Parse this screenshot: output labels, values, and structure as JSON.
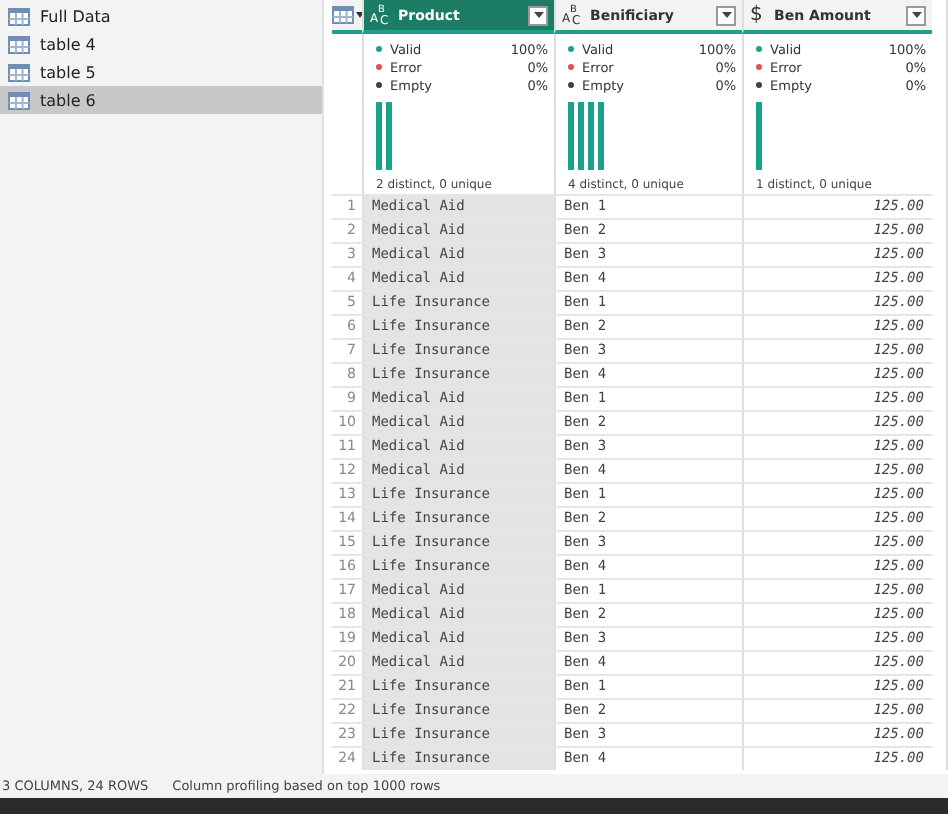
{
  "sidebar": {
    "items": [
      {
        "label": "Full Data",
        "selected": false
      },
      {
        "label": "table 4",
        "selected": false
      },
      {
        "label": "table 5",
        "selected": false
      },
      {
        "label": "table 6",
        "selected": true
      }
    ]
  },
  "table": {
    "columns": [
      {
        "name": "Product",
        "kind": "text",
        "type_glyph": "ABC",
        "selected": true,
        "stats": [
          {
            "label": "Valid",
            "value": "100%",
            "color": "#1aa38a"
          },
          {
            "label": "Error",
            "value": "0%",
            "color": "#e0505a"
          },
          {
            "label": "Empty",
            "value": "0%",
            "color": "#404040"
          }
        ],
        "distinct": "2 distinct, 0 unique"
      },
      {
        "name": "Benificiary",
        "kind": "text",
        "type_glyph": "ABC",
        "selected": false,
        "stats": [
          {
            "label": "Valid",
            "value": "100%",
            "color": "#1aa38a"
          },
          {
            "label": "Error",
            "value": "0%",
            "color": "#e0505a"
          },
          {
            "label": "Empty",
            "value": "0%",
            "color": "#404040"
          }
        ],
        "distinct": "4 distinct, 0 unique"
      },
      {
        "name": "Ben Amount",
        "kind": "currency",
        "type_glyph": "$",
        "selected": false,
        "stats": [
          {
            "label": "Valid",
            "value": "100%",
            "color": "#1aa38a"
          },
          {
            "label": "Error",
            "value": "0%",
            "color": "#e0505a"
          },
          {
            "label": "Empty",
            "value": "0%",
            "color": "#404040"
          }
        ],
        "distinct": "1 distinct, 0 unique"
      }
    ],
    "rows": [
      {
        "number": "1",
        "cells": [
          "Medical Aid",
          "Ben 1",
          "125.00"
        ]
      },
      {
        "number": "2",
        "cells": [
          "Medical Aid",
          "Ben 2",
          "125.00"
        ]
      },
      {
        "number": "3",
        "cells": [
          "Medical Aid",
          "Ben 3",
          "125.00"
        ]
      },
      {
        "number": "4",
        "cells": [
          "Medical Aid",
          "Ben 4",
          "125.00"
        ]
      },
      {
        "number": "5",
        "cells": [
          "Life Insurance",
          "Ben 1",
          "125.00"
        ]
      },
      {
        "number": "6",
        "cells": [
          "Life Insurance",
          "Ben 2",
          "125.00"
        ]
      },
      {
        "number": "7",
        "cells": [
          "Life Insurance",
          "Ben 3",
          "125.00"
        ]
      },
      {
        "number": "8",
        "cells": [
          "Life Insurance",
          "Ben 4",
          "125.00"
        ]
      },
      {
        "number": "9",
        "cells": [
          "Medical Aid",
          "Ben 1",
          "125.00"
        ]
      },
      {
        "number": "10",
        "cells": [
          "Medical Aid",
          "Ben 2",
          "125.00"
        ]
      },
      {
        "number": "11",
        "cells": [
          "Medical Aid",
          "Ben 3",
          "125.00"
        ]
      },
      {
        "number": "12",
        "cells": [
          "Medical Aid",
          "Ben 4",
          "125.00"
        ]
      },
      {
        "number": "13",
        "cells": [
          "Life Insurance",
          "Ben 1",
          "125.00"
        ]
      },
      {
        "number": "14",
        "cells": [
          "Life Insurance",
          "Ben 2",
          "125.00"
        ]
      },
      {
        "number": "15",
        "cells": [
          "Life Insurance",
          "Ben 3",
          "125.00"
        ]
      },
      {
        "number": "16",
        "cells": [
          "Life Insurance",
          "Ben 4",
          "125.00"
        ]
      },
      {
        "number": "17",
        "cells": [
          "Medical Aid",
          "Ben 1",
          "125.00"
        ]
      },
      {
        "number": "18",
        "cells": [
          "Medical Aid",
          "Ben 2",
          "125.00"
        ]
      },
      {
        "number": "19",
        "cells": [
          "Medical Aid",
          "Ben 3",
          "125.00"
        ]
      },
      {
        "number": "20",
        "cells": [
          "Medical Aid",
          "Ben 4",
          "125.00"
        ]
      },
      {
        "number": "21",
        "cells": [
          "Life Insurance",
          "Ben 1",
          "125.00"
        ]
      },
      {
        "number": "22",
        "cells": [
          "Life Insurance",
          "Ben 2",
          "125.00"
        ]
      },
      {
        "number": "23",
        "cells": [
          "Life Insurance",
          "Ben 3",
          "125.00"
        ]
      },
      {
        "number": "24",
        "cells": [
          "Life Insurance",
          "Ben 4",
          "125.00"
        ]
      }
    ]
  },
  "status_bar": {
    "counts": "3 COLUMNS, 24 ROWS",
    "profiling": "Column profiling based on top 1000 rows"
  }
}
